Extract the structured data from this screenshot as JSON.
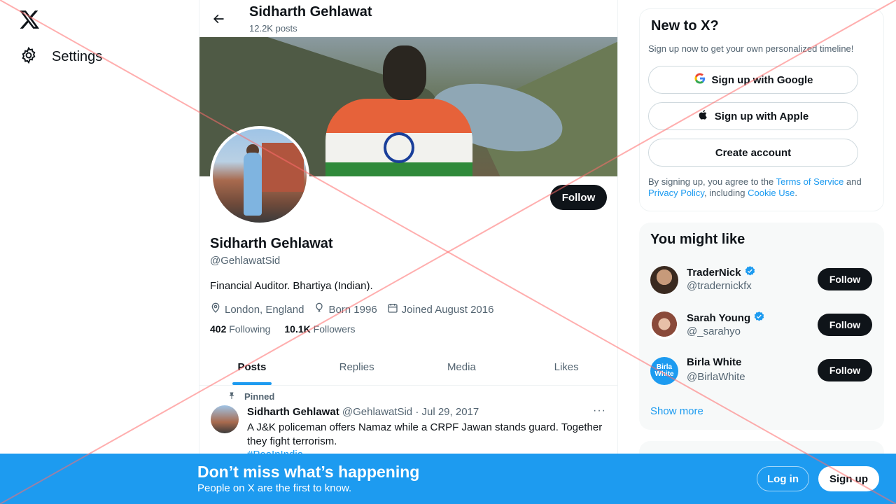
{
  "nav": {
    "settings_label": "Settings"
  },
  "header": {
    "name": "Sidharth Gehlawat",
    "posts_count": "12.2K posts"
  },
  "profile": {
    "follow_label": "Follow",
    "name": "Sidharth Gehlawat",
    "handle": "@GehlawatSid",
    "bio": "Financial Auditor. Bhartiya (Indian).",
    "location": "London, England",
    "born": "Born 1996",
    "joined": "Joined August 2016",
    "following_count": "402",
    "following_label": "Following",
    "followers_count": "10.1K",
    "followers_label": "Followers"
  },
  "tabs": [
    {
      "label": "Posts",
      "active": true
    },
    {
      "label": "Replies"
    },
    {
      "label": "Media"
    },
    {
      "label": "Likes"
    }
  ],
  "tweet": {
    "pinned_label": "Pinned",
    "author": "Sidharth Gehlawat",
    "handle": "@GehlawatSid",
    "separator": "·",
    "date": "Jul 29, 2017",
    "more": "···",
    "text": "A J&K policeman offers Namaz while a CRPF Jawan stands guard. Together they fight terrorism.",
    "hashtag": "#PeaInIndia"
  },
  "signup_card": {
    "title": "New to X?",
    "subtitle": "Sign up now to get your own personalized timeline!",
    "google_label": "Sign up with Google",
    "apple_label": "Sign up with Apple",
    "create_label": "Create account",
    "legal_prefix": "By signing up, you agree to the ",
    "terms": "Terms of Service",
    "legal_and": " and ",
    "privacy": "Privacy Policy",
    "legal_including": ", including ",
    "cookie": "Cookie Use",
    "legal_suffix": "."
  },
  "suggestions": {
    "title": "You might like",
    "show_more": "Show more",
    "users": [
      {
        "name": "TraderNick",
        "handle": "@tradernickfx",
        "verified": true,
        "follow_label": "Follow"
      },
      {
        "name": "Sarah Young",
        "handle": "@_sarahyo",
        "verified": true,
        "follow_label": "Follow"
      },
      {
        "name": "Birla White",
        "handle": "@BirlaWhite",
        "verified": false,
        "follow_label": "Follow",
        "avatar_text": "Birla White"
      }
    ]
  },
  "bottom_bar": {
    "title": "Don’t miss what’s happening",
    "subtitle": "People on X are the first to know.",
    "login_label": "Log in",
    "signup_label": "Sign up"
  },
  "colors": {
    "accent": "#1d9bf0",
    "text": "#0f1419",
    "muted": "#536471",
    "overlay_cross": "#ff6b6b"
  }
}
